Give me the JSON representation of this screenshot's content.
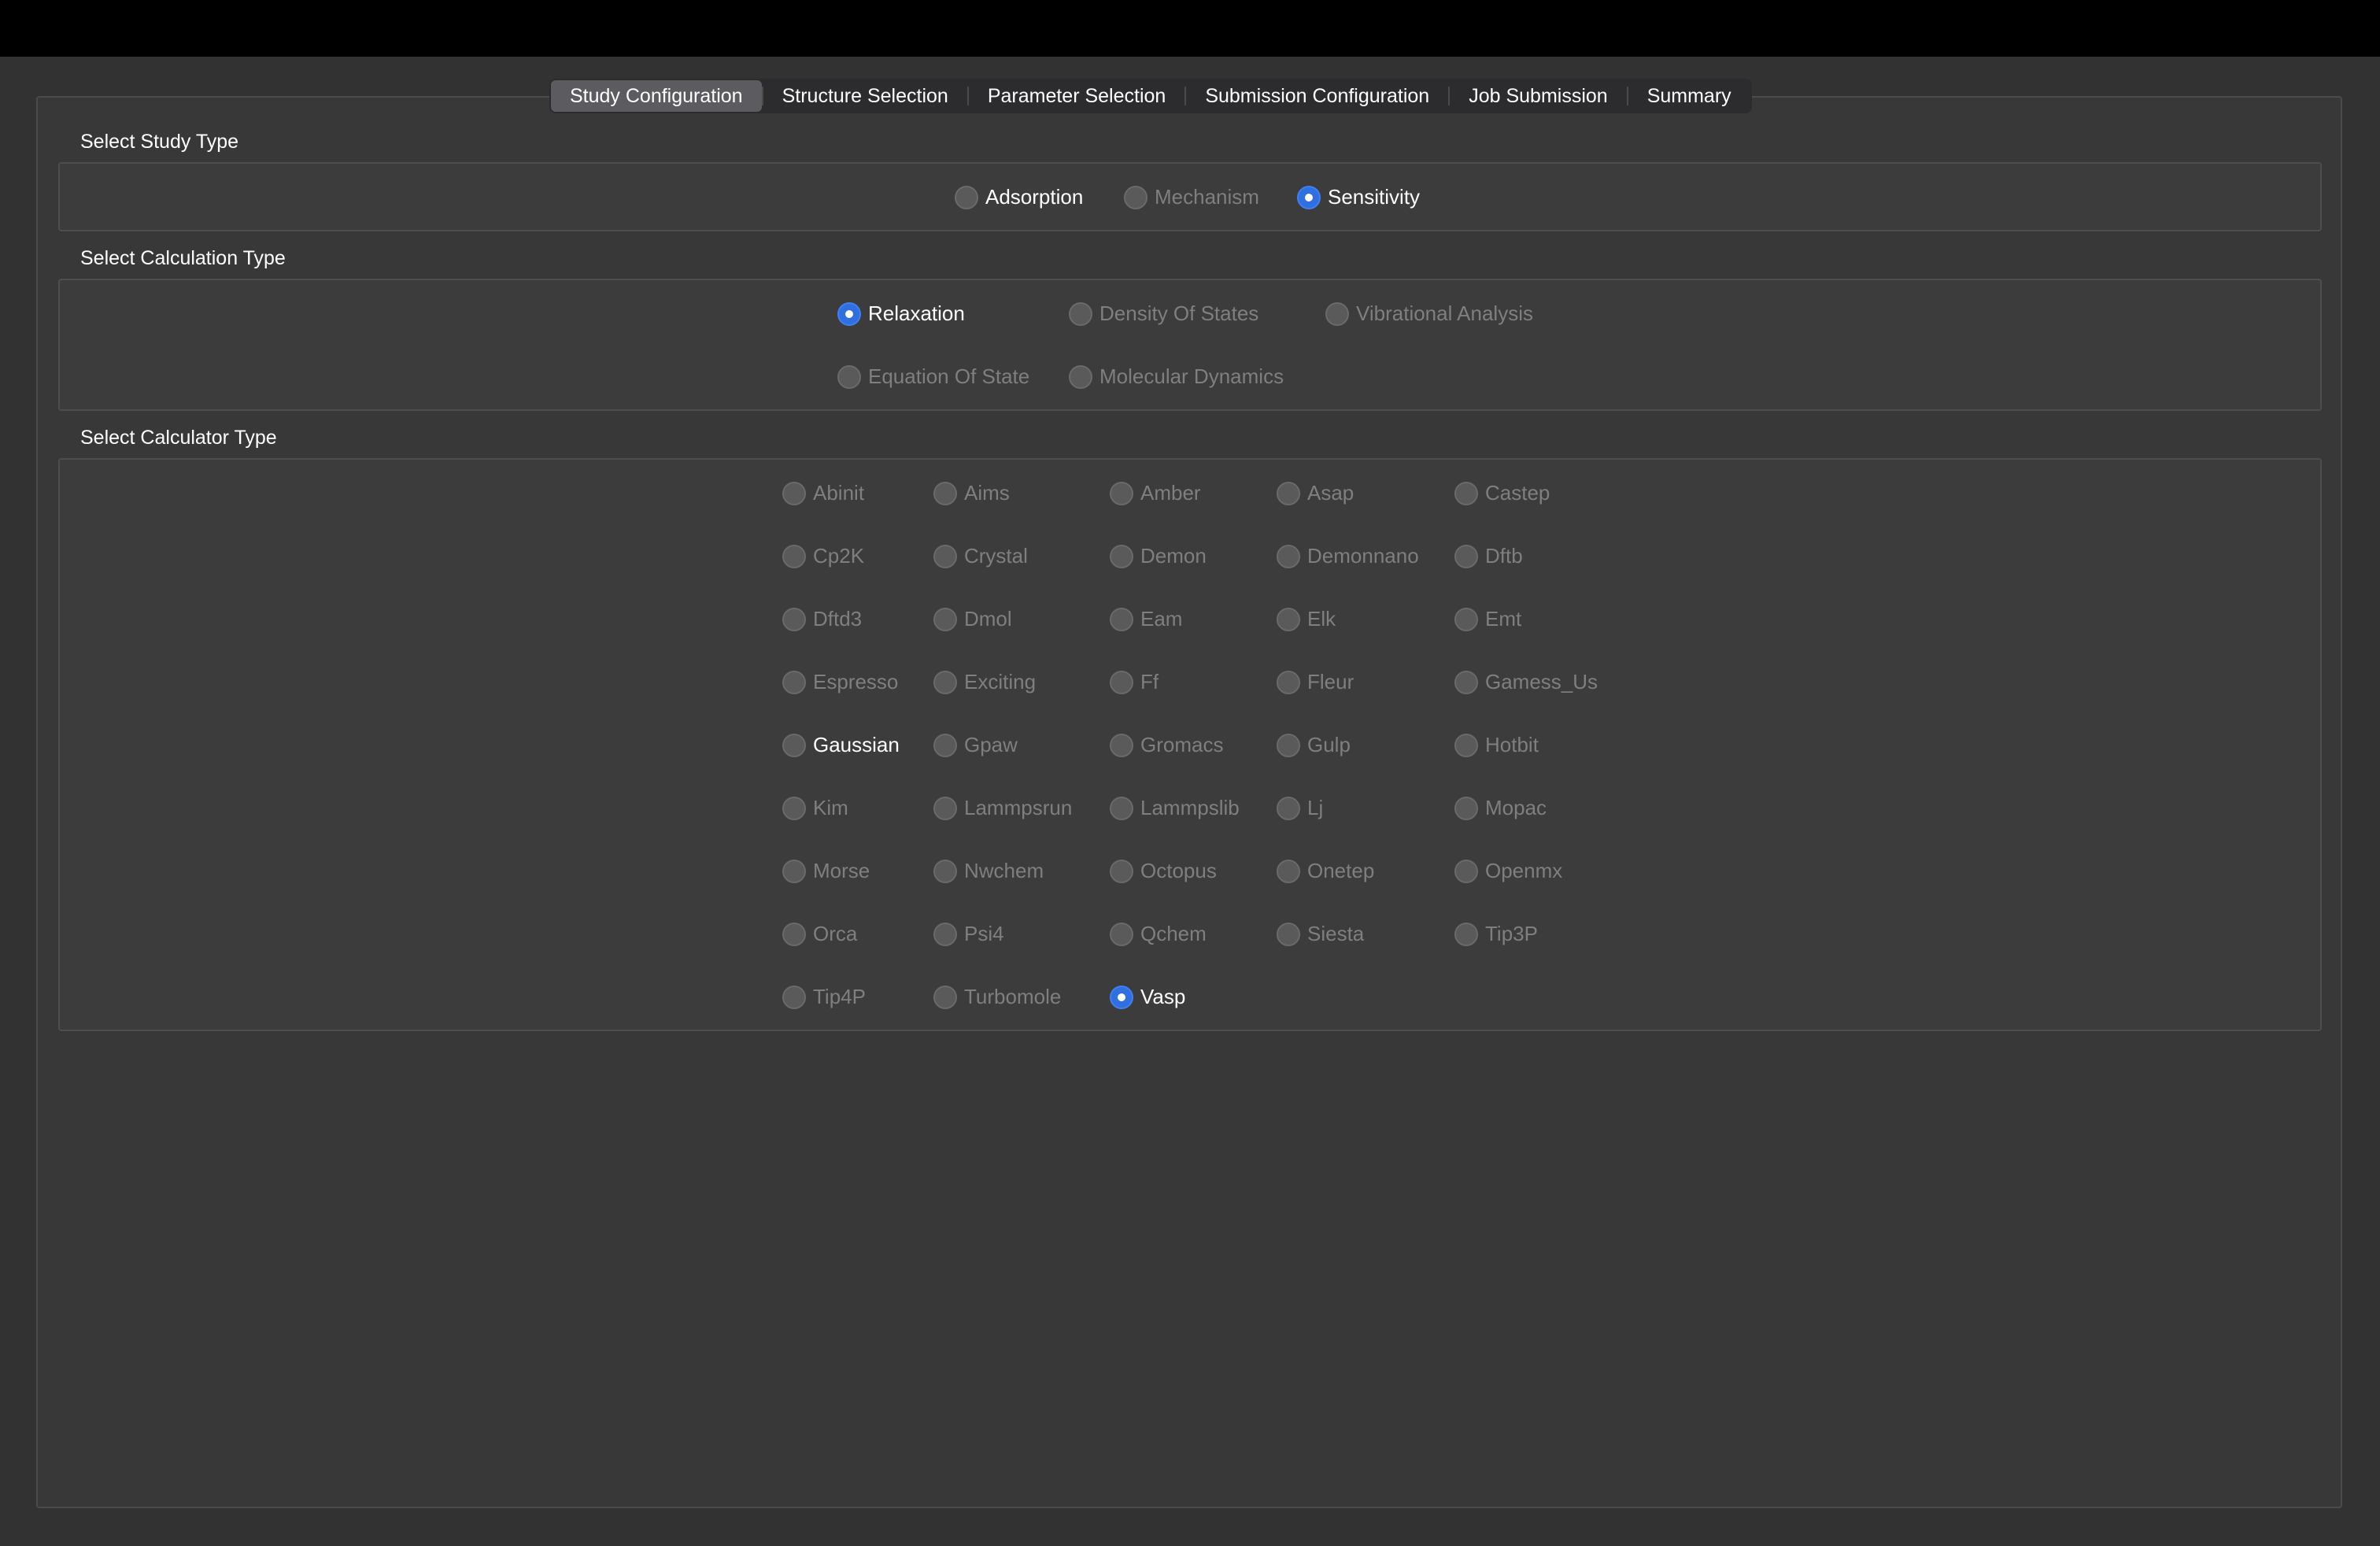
{
  "tabs": [
    {
      "label": "Study Configuration",
      "active": true
    },
    {
      "label": "Structure Selection",
      "active": false
    },
    {
      "label": "Parameter Selection",
      "active": false
    },
    {
      "label": "Submission Configuration",
      "active": false
    },
    {
      "label": "Job Submission",
      "active": false
    },
    {
      "label": "Summary",
      "active": false
    }
  ],
  "study_type": {
    "title": "Select Study Type",
    "options": [
      {
        "label": "Adsorption",
        "enabled": true,
        "checked": false
      },
      {
        "label": "Mechanism",
        "enabled": false,
        "checked": false
      },
      {
        "label": "Sensitivity",
        "enabled": true,
        "checked": true
      }
    ]
  },
  "calculation_type": {
    "title": "Select Calculation Type",
    "options": [
      {
        "label": "Relaxation",
        "enabled": true,
        "checked": true
      },
      {
        "label": "Density Of States",
        "enabled": false,
        "checked": false
      },
      {
        "label": "Vibrational Analysis",
        "enabled": false,
        "checked": false
      },
      {
        "label": "Equation Of State",
        "enabled": false,
        "checked": false
      },
      {
        "label": "Molecular Dynamics",
        "enabled": false,
        "checked": false
      }
    ]
  },
  "calculator_type": {
    "title": "Select Calculator Type",
    "options": [
      {
        "label": "Abinit",
        "enabled": false,
        "checked": false
      },
      {
        "label": "Aims",
        "enabled": false,
        "checked": false
      },
      {
        "label": "Amber",
        "enabled": false,
        "checked": false
      },
      {
        "label": "Asap",
        "enabled": false,
        "checked": false
      },
      {
        "label": "Castep",
        "enabled": false,
        "checked": false
      },
      {
        "label": "Cp2K",
        "enabled": false,
        "checked": false
      },
      {
        "label": "Crystal",
        "enabled": false,
        "checked": false
      },
      {
        "label": "Demon",
        "enabled": false,
        "checked": false
      },
      {
        "label": "Demonnano",
        "enabled": false,
        "checked": false
      },
      {
        "label": "Dftb",
        "enabled": false,
        "checked": false
      },
      {
        "label": "Dftd3",
        "enabled": false,
        "checked": false
      },
      {
        "label": "Dmol",
        "enabled": false,
        "checked": false
      },
      {
        "label": "Eam",
        "enabled": false,
        "checked": false
      },
      {
        "label": "Elk",
        "enabled": false,
        "checked": false
      },
      {
        "label": "Emt",
        "enabled": false,
        "checked": false
      },
      {
        "label": "Espresso",
        "enabled": false,
        "checked": false
      },
      {
        "label": "Exciting",
        "enabled": false,
        "checked": false
      },
      {
        "label": "Ff",
        "enabled": false,
        "checked": false
      },
      {
        "label": "Fleur",
        "enabled": false,
        "checked": false
      },
      {
        "label": "Gamess_Us",
        "enabled": false,
        "checked": false
      },
      {
        "label": "Gaussian",
        "enabled": true,
        "checked": false
      },
      {
        "label": "Gpaw",
        "enabled": false,
        "checked": false
      },
      {
        "label": "Gromacs",
        "enabled": false,
        "checked": false
      },
      {
        "label": "Gulp",
        "enabled": false,
        "checked": false
      },
      {
        "label": "Hotbit",
        "enabled": false,
        "checked": false
      },
      {
        "label": "Kim",
        "enabled": false,
        "checked": false
      },
      {
        "label": "Lammpsrun",
        "enabled": false,
        "checked": false
      },
      {
        "label": "Lammpslib",
        "enabled": false,
        "checked": false
      },
      {
        "label": "Lj",
        "enabled": false,
        "checked": false
      },
      {
        "label": "Mopac",
        "enabled": false,
        "checked": false
      },
      {
        "label": "Morse",
        "enabled": false,
        "checked": false
      },
      {
        "label": "Nwchem",
        "enabled": false,
        "checked": false
      },
      {
        "label": "Octopus",
        "enabled": false,
        "checked": false
      },
      {
        "label": "Onetep",
        "enabled": false,
        "checked": false
      },
      {
        "label": "Openmx",
        "enabled": false,
        "checked": false
      },
      {
        "label": "Orca",
        "enabled": false,
        "checked": false
      },
      {
        "label": "Psi4",
        "enabled": false,
        "checked": false
      },
      {
        "label": "Qchem",
        "enabled": false,
        "checked": false
      },
      {
        "label": "Siesta",
        "enabled": false,
        "checked": false
      },
      {
        "label": "Tip3P",
        "enabled": false,
        "checked": false
      },
      {
        "label": "Tip4P",
        "enabled": false,
        "checked": false
      },
      {
        "label": "Turbomole",
        "enabled": false,
        "checked": false
      },
      {
        "label": "Vasp",
        "enabled": true,
        "checked": true
      }
    ]
  },
  "colors": {
    "accent": "#2f6fe0",
    "window_bg": "#323232",
    "pane_bg": "#383838",
    "text": "#ffffff",
    "text_disabled": "#7f7f7f"
  }
}
